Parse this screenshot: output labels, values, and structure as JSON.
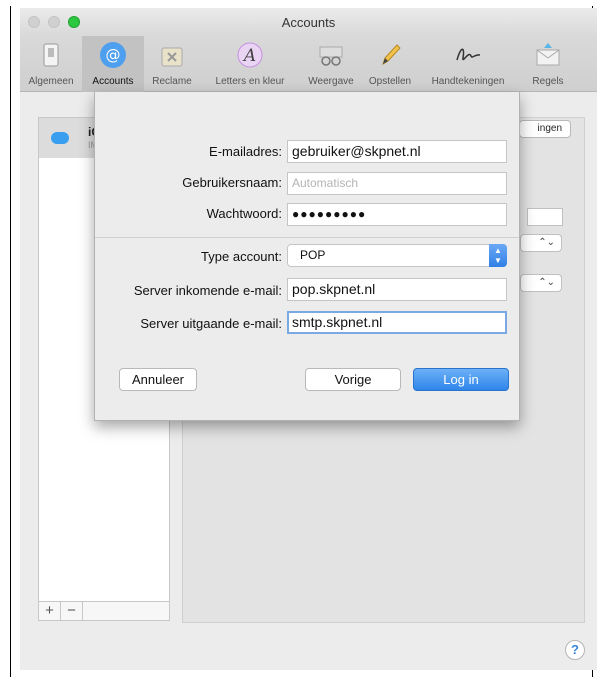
{
  "window": {
    "title": "Accounts"
  },
  "toolbar": {
    "tabs": [
      {
        "label": "Algemeen",
        "icon": "switch-icon"
      },
      {
        "label": "Accounts",
        "icon": "at-sign-icon",
        "active": true
      },
      {
        "label": "Reclame",
        "icon": "trash-junk-icon"
      },
      {
        "label": "Letters en kleur",
        "icon": "fonts-colors-icon"
      },
      {
        "label": "Weergave",
        "icon": "glasses-icon"
      },
      {
        "label": "Opstellen",
        "icon": "pencil-icon"
      },
      {
        "label": "Handtekeningen",
        "icon": "signature-icon"
      },
      {
        "label": "Regels",
        "icon": "rules-envelope-icon"
      }
    ]
  },
  "sidebar": {
    "account_name": "iC",
    "account_sub": "IM",
    "add_label": "+",
    "remove_label": "−"
  },
  "background": {
    "details_button_label": "ingen"
  },
  "sheet": {
    "fields": {
      "email_label": "E-mailadres:",
      "email_value": "gebruiker@skpnet.nl",
      "username_label": "Gebruikersnaam:",
      "username_placeholder": "Automatisch",
      "password_label": "Wachtwoord:",
      "password_value": "●●●●●●●●●",
      "type_label": "Type account:",
      "type_value": "POP",
      "incoming_label": "Server inkomende e-mail:",
      "incoming_value": "pop.skpnet.nl",
      "outgoing_label": "Server uitgaande e-mail:",
      "outgoing_value": "smtp.skpnet.nl"
    },
    "buttons": {
      "cancel": "Annuleer",
      "back": "Vorige",
      "login": "Log in"
    }
  },
  "help": {
    "label": "?"
  },
  "colors": {
    "accent": "#2f86ea",
    "focus_ring": "#7aa9e4",
    "zoom_button": "#2bc840"
  }
}
